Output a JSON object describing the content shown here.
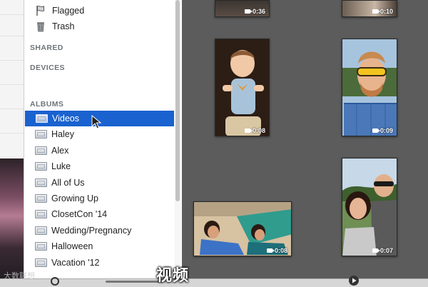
{
  "sidebar": {
    "system_items": [
      {
        "label": "Flagged",
        "icon": "flag-icon"
      },
      {
        "label": "Trash",
        "icon": "trash-icon"
      }
    ],
    "headers": {
      "shared": "SHARED",
      "devices": "DEVICES",
      "albums": "ALBUMS"
    },
    "albums": [
      {
        "label": "Videos",
        "selected": true
      },
      {
        "label": "Haley"
      },
      {
        "label": "Alex"
      },
      {
        "label": "Luke"
      },
      {
        "label": "All of Us"
      },
      {
        "label": "Growing Up"
      },
      {
        "label": "ClosetCon '14"
      },
      {
        "label": "Wedding/Pregnancy"
      },
      {
        "label": "Halloween"
      },
      {
        "label": "Vacation '12"
      }
    ]
  },
  "videos": [
    {
      "duration": "0:36"
    },
    {
      "duration": "0:10"
    },
    {
      "duration": "0:08"
    },
    {
      "duration": "0:09"
    },
    {
      "duration": "0:08"
    },
    {
      "duration": "0:07"
    }
  ],
  "caption": "视频",
  "watermark": "大数联想",
  "colors": {
    "selection": "#1a62cf",
    "grid_background": "#5c5c5c",
    "sidebar_background": "#ffffff"
  }
}
